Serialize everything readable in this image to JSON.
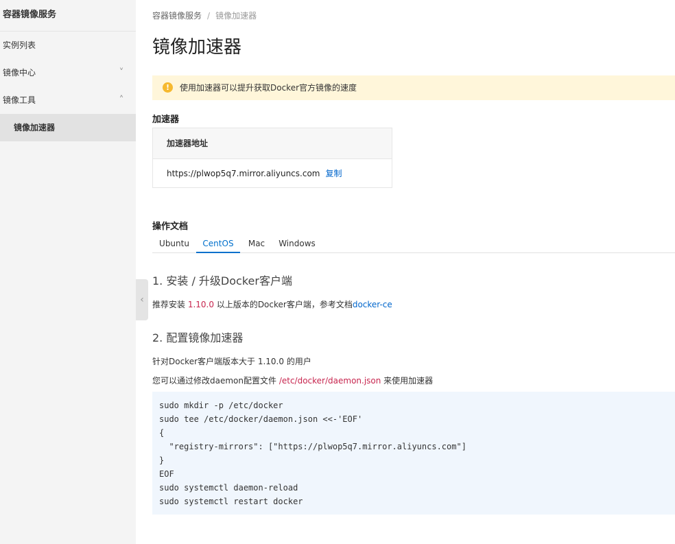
{
  "sidebar": {
    "title": "容器镜像服务",
    "items": [
      {
        "label": "实例列表"
      },
      {
        "label": "镜像中心",
        "chevron": "˅"
      },
      {
        "label": "镜像工具",
        "chevron": "˄"
      },
      {
        "label": "镜像加速器"
      }
    ]
  },
  "collapse_glyph": "‹",
  "breadcrumb": {
    "root": "容器镜像服务",
    "separator": "/",
    "current": "镜像加速器"
  },
  "page_title": "镜像加速器",
  "notice": {
    "icon": "!",
    "text": "使用加速器可以提升获取Docker官方镜像的速度"
  },
  "accelerator": {
    "heading": "加速器",
    "column_header": "加速器地址",
    "address": "https://plwop5q7.mirror.aliyuncs.com",
    "copy_label": "复制"
  },
  "docs": {
    "heading": "操作文档",
    "tabs": [
      "Ubuntu",
      "CentOS",
      "Mac",
      "Windows"
    ],
    "active_tab": "CentOS"
  },
  "step1": {
    "title": "1. 安装 / 升级Docker客户端",
    "text_a": "推荐安装 ",
    "version": "1.10.0",
    "text_b": " 以上版本的Docker客户端，参考文档",
    "link": "docker-ce"
  },
  "step2": {
    "title": "2. 配置镜像加速器",
    "line1": "针对Docker客户端版本大于 1.10.0 的用户",
    "line2_a": "您可以通过修改daemon配置文件 ",
    "line2_path": "/etc/docker/daemon.json",
    "line2_b": " 来使用加速器"
  },
  "code": [
    "sudo mkdir -p /etc/docker",
    "sudo tee /etc/docker/daemon.json <<-'EOF'",
    "{",
    "  \"registry-mirrors\": [\"https://plwop5q7.mirror.aliyuncs.com\"]",
    "}",
    "EOF",
    "sudo systemctl daemon-reload",
    "sudo systemctl restart docker"
  ],
  "colors": {
    "accent": "#0070cc",
    "link": "#0066cc",
    "code_highlight": "#c7254e",
    "notice_bg": "#fff6da",
    "warning_icon": "#f6b92f",
    "code_bg": "#f0f6fd"
  }
}
